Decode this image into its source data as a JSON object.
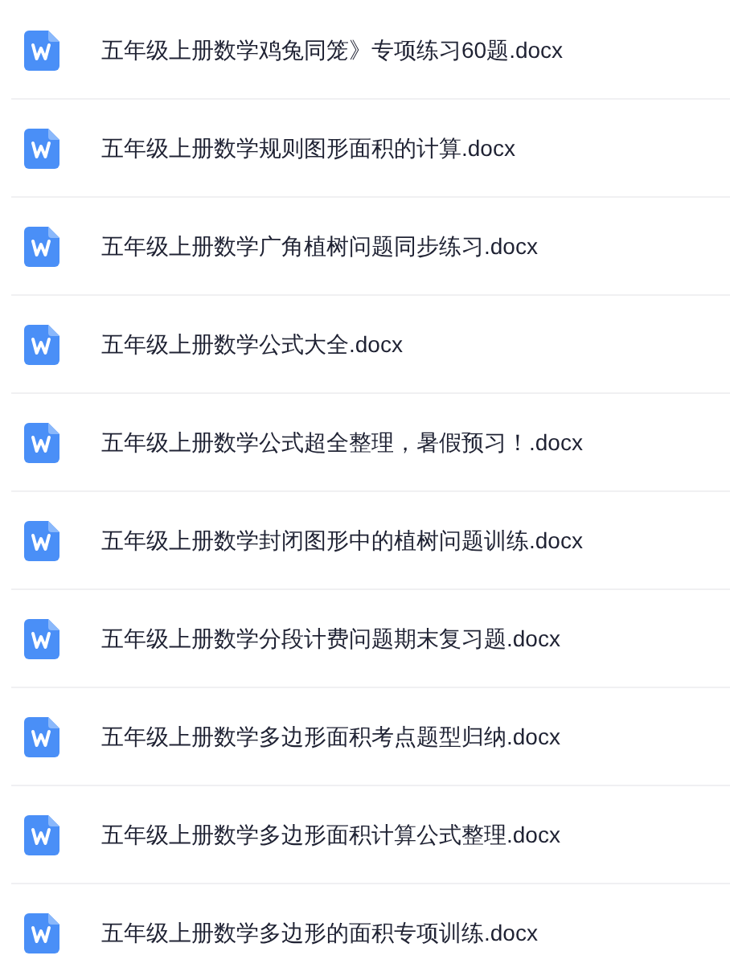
{
  "files": [
    {
      "name": "五年级上册数学鸡兔同笼》专项练习60题.docx"
    },
    {
      "name": "五年级上册数学规则图形面积的计算.docx"
    },
    {
      "name": "五年级上册数学广角植树问题同步练习.docx"
    },
    {
      "name": "五年级上册数学公式大全.docx"
    },
    {
      "name": "五年级上册数学公式超全整理，暑假预习！.docx"
    },
    {
      "name": "五年级上册数学封闭图形中的植树问题训练.docx"
    },
    {
      "name": "五年级上册数学分段计费问题期末复习题.docx"
    },
    {
      "name": "五年级上册数学多边形面积考点题型归纳.docx"
    },
    {
      "name": "五年级上册数学多边形面积计算公式整理.docx"
    },
    {
      "name": "五年级上册数学多边形的面积专项训练.docx"
    }
  ]
}
